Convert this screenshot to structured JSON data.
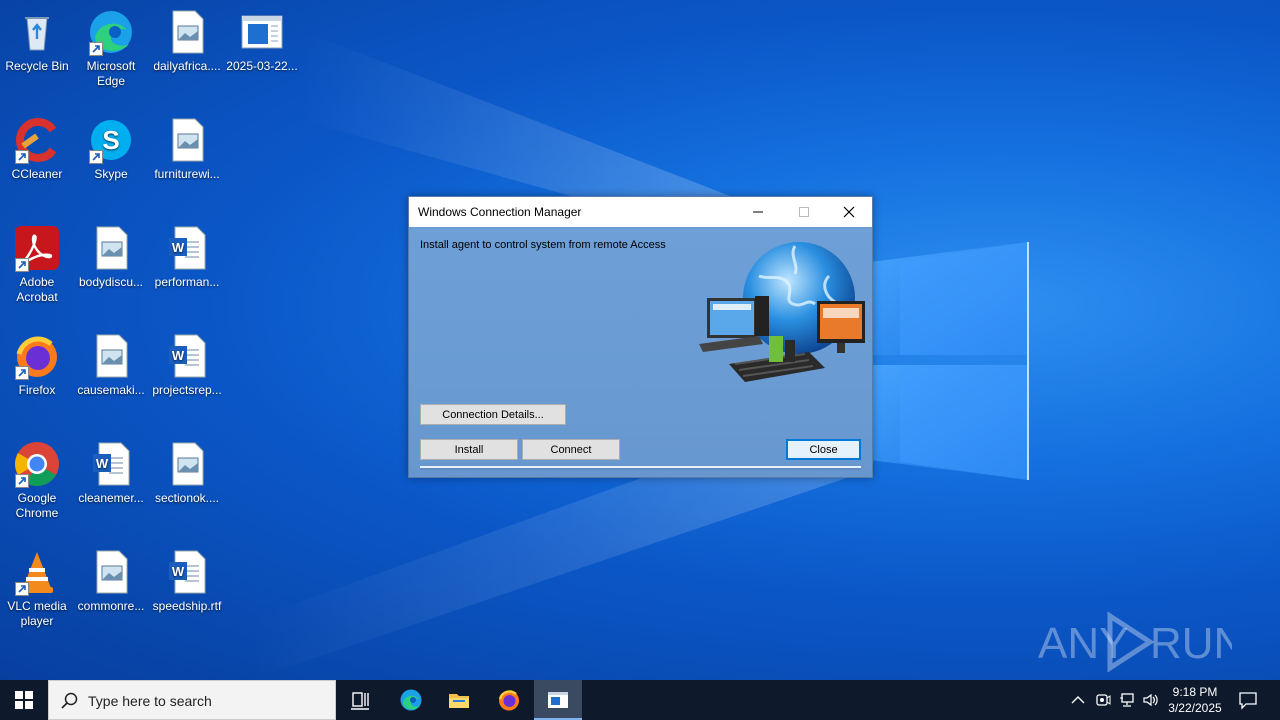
{
  "desktop": {
    "icons": [
      {
        "label": "Recycle Bin",
        "icon": "recycle-bin-icon"
      },
      {
        "label": "Microsoft Edge",
        "icon": "edge-icon"
      },
      {
        "label": "dailyafrica....",
        "icon": "image-file-icon"
      },
      {
        "label": "2025-03-22...",
        "icon": "app-window-icon"
      },
      {
        "label": "CCleaner",
        "icon": "ccleaner-icon"
      },
      {
        "label": "Skype",
        "icon": "skype-icon"
      },
      {
        "label": "furniturewi...",
        "icon": "image-file-icon"
      },
      {
        "label": "Adobe Acrobat",
        "icon": "acrobat-icon"
      },
      {
        "label": "bodydiscu...",
        "icon": "image-file-icon"
      },
      {
        "label": "performan...",
        "icon": "word-doc-icon"
      },
      {
        "label": "Firefox",
        "icon": "firefox-icon"
      },
      {
        "label": "causemaki...",
        "icon": "image-file-icon"
      },
      {
        "label": "projectsrep...",
        "icon": "word-doc-icon"
      },
      {
        "label": "Google Chrome",
        "icon": "chrome-icon"
      },
      {
        "label": "cleanemer...",
        "icon": "word-doc-icon"
      },
      {
        "label": "sectionok....",
        "icon": "image-file-icon"
      },
      {
        "label": "VLC media player",
        "icon": "vlc-icon"
      },
      {
        "label": "commonre...",
        "icon": "image-file-icon"
      },
      {
        "label": "speedship.rtf",
        "icon": "word-doc-icon"
      }
    ]
  },
  "dialog": {
    "title": "Windows Connection Manager",
    "message": "Install agent to control system from remote Access",
    "connection_details_label": "Connection Details...",
    "install_label": "Install",
    "connect_label": "Connect",
    "close_label": "Close"
  },
  "taskbar": {
    "search_placeholder": "Type here to search",
    "time": "9:18 PM",
    "date": "3/22/2025"
  },
  "watermark": {
    "text": "ANY RUN"
  },
  "colors": {
    "accent": "#0078d7",
    "dialog_bg": "#6a9bd4",
    "taskbar_bg": "#0e1a2b"
  }
}
